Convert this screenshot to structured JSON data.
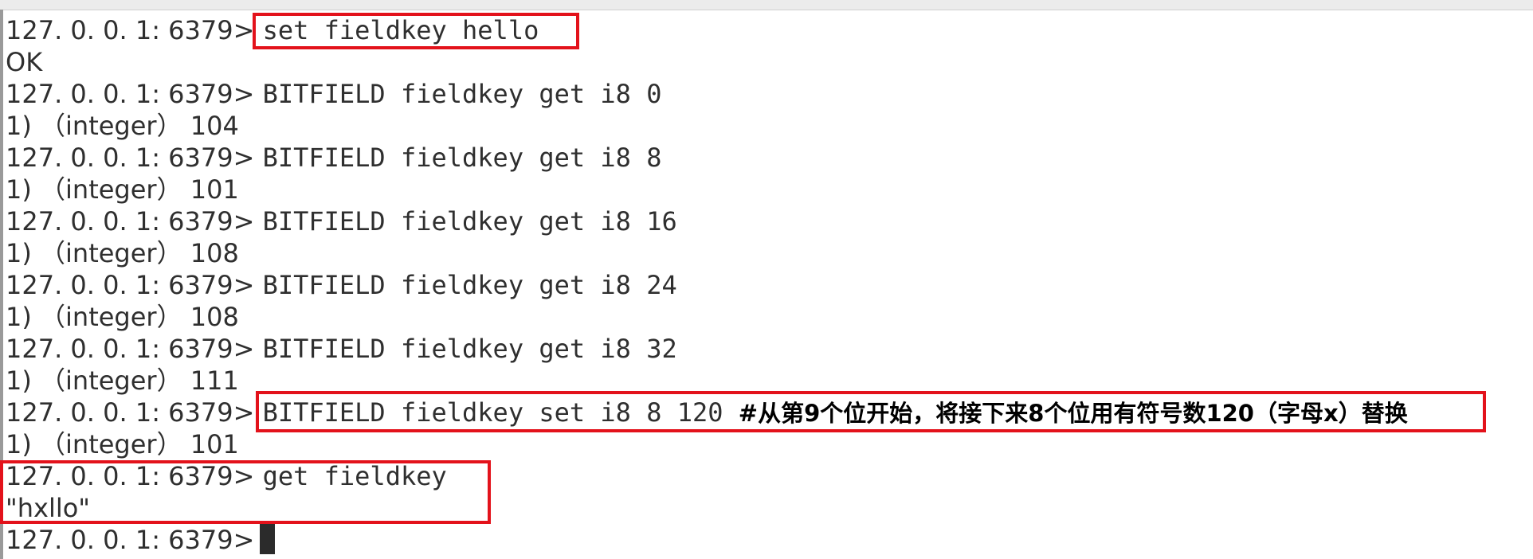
{
  "terminal": {
    "prompt": "127. 0. 0. 1: 6379> ",
    "lines": [
      {
        "kind": "prompt",
        "cmd": "set fieldkey hello"
      },
      {
        "kind": "output",
        "text": "OK"
      },
      {
        "kind": "prompt",
        "cmd": "BITFIELD fieldkey get i8 0"
      },
      {
        "kind": "output",
        "text": "1) （integer） 104"
      },
      {
        "kind": "prompt",
        "cmd": "BITFIELD fieldkey get i8 8"
      },
      {
        "kind": "output",
        "text": "1) （integer） 101"
      },
      {
        "kind": "prompt",
        "cmd": "BITFIELD fieldkey get i8 16"
      },
      {
        "kind": "output",
        "text": "1) （integer） 108"
      },
      {
        "kind": "prompt",
        "cmd": "BITFIELD fieldkey get i8 24"
      },
      {
        "kind": "output",
        "text": "1) （integer） 108"
      },
      {
        "kind": "prompt",
        "cmd": "BITFIELD fieldkey get i8 32"
      },
      {
        "kind": "output",
        "text": "1) （integer） 111"
      },
      {
        "kind": "prompt",
        "cmd": "BITFIELD fieldkey set i8 8 120 ",
        "note": "#从第9个位开始，将接下来8个位用有符号数120（字母x）替换"
      },
      {
        "kind": "output",
        "text": "1) （integer） 101"
      },
      {
        "kind": "prompt",
        "cmd": "get fieldkey"
      },
      {
        "kind": "output",
        "text": "\"hxllo\""
      },
      {
        "kind": "prompt",
        "cmd": ""
      }
    ]
  },
  "colors": {
    "text": "#2f2f2f",
    "highlight_box": "#e3121b",
    "background": "#ffffff"
  }
}
